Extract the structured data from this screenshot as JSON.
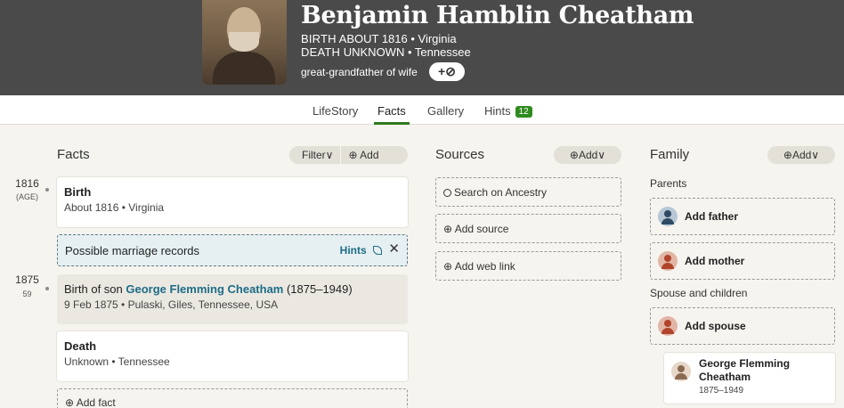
{
  "person": {
    "name": "Benjamin Hamblin Cheatham",
    "birth_label": "BIRTH",
    "birth_value": "ABOUT 1816 • Virginia",
    "death_label": "DEATH",
    "death_value": "UNKNOWN • Tennessee",
    "relation": "great-grandfather of wife",
    "tag_button": "+⊘"
  },
  "tabs": [
    {
      "label": "LifeStory"
    },
    {
      "label": "Facts"
    },
    {
      "label": "Gallery"
    },
    {
      "label": "Hints",
      "badge": "12"
    }
  ],
  "facts": {
    "title": "Facts",
    "filter_label": "Filter∨",
    "add_label": "⊕ Add",
    "timeline": [
      {
        "year": "1816",
        "age": "(AGE)"
      },
      {
        "year": "1875",
        "age": "59"
      }
    ],
    "birth": {
      "title": "Birth",
      "detail": "About 1816 • Virginia"
    },
    "marriage": {
      "title": "Possible marriage records",
      "hints": "Hints",
      "close": "✕"
    },
    "birth_son": {
      "prefix": "Birth of son ",
      "link": "George Flemming Cheatham",
      "suffix": " (1875–1949)",
      "detail": "9 Feb 1875 • Pulaski, Giles, Tennessee, USA"
    },
    "death": {
      "title": "Death",
      "detail": "Unknown • Tennessee"
    },
    "add_fact": "⊕ Add fact"
  },
  "sources": {
    "title": "Sources",
    "add_label": "⊕Add∨",
    "search": "Search on Ancestry",
    "add_source": "⊕ Add source",
    "add_web_link": "⊕ Add web link"
  },
  "family": {
    "title": "Family",
    "add_label": "⊕Add∨",
    "parents_label": "Parents",
    "add_father": "Add father",
    "add_mother": "Add mother",
    "spouse_label": "Spouse and children",
    "add_spouse": "Add spouse",
    "child": {
      "name": "George Flemming Cheatham",
      "years": "1875–1949"
    }
  }
}
